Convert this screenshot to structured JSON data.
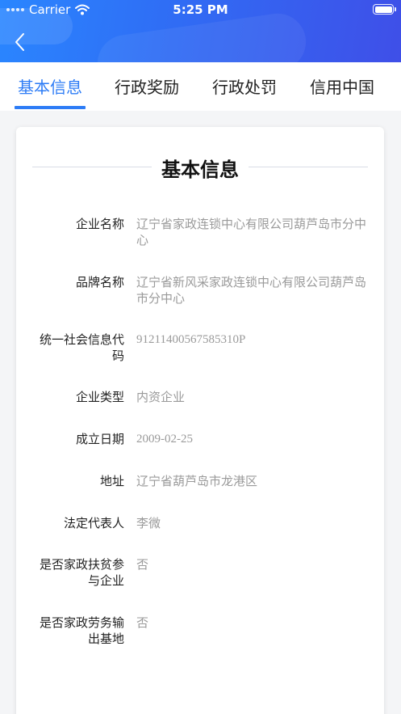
{
  "status_bar": {
    "carrier": "Carrier",
    "time": "5:25 PM"
  },
  "nav": {
    "back_icon": "chevron-left-icon"
  },
  "tabs": [
    {
      "label": "基本信息",
      "active": true
    },
    {
      "label": "行政奖励",
      "active": false
    },
    {
      "label": "行政处罚",
      "active": false
    },
    {
      "label": "信用中国",
      "active": false
    }
  ],
  "card": {
    "title": "基本信息",
    "fields": [
      {
        "label": "企业名称",
        "value": "辽宁省家政连锁中心有限公司葫芦岛市分中心"
      },
      {
        "label": "品牌名称",
        "value": "辽宁省新风采家政连锁中心有限公司葫芦岛市分中心"
      },
      {
        "label": "统一社会信息代码",
        "value": "91211400567585310P"
      },
      {
        "label": "企业类型",
        "value": "内资企业"
      },
      {
        "label": "成立日期",
        "value": "2009-02-25"
      },
      {
        "label": "地址",
        "value": "辽宁省葫芦岛市龙港区"
      },
      {
        "label": "法定代表人",
        "value": "李微"
      },
      {
        "label": "是否家政扶贫参与企业",
        "value": "否"
      },
      {
        "label": "是否家政劳务输出基地",
        "value": "否"
      }
    ]
  },
  "colors": {
    "accent": "#2d7cf6",
    "header_start": "#2a86ff",
    "header_end": "#3f4fe8"
  }
}
